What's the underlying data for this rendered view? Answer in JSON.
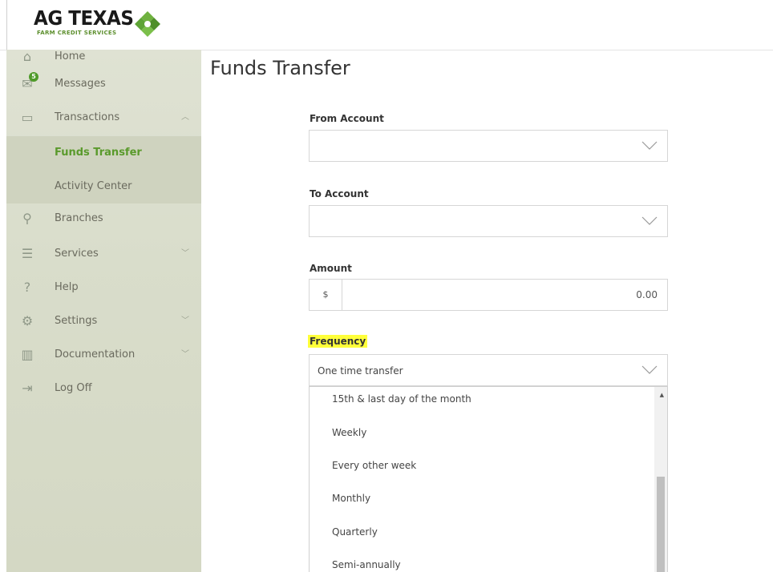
{
  "brand": {
    "name": "AG TEXAS",
    "tagline": "FARM CREDIT SERVICES",
    "accent": "#5a9a2c"
  },
  "sidebar": {
    "items": [
      {
        "label": "Home",
        "icon": "home-icon"
      },
      {
        "label": "Messages",
        "icon": "envelope-icon",
        "badge": "5"
      },
      {
        "label": "Transactions",
        "icon": "card-icon",
        "expanded": true
      },
      {
        "label": "Funds Transfer",
        "sub": true,
        "active": true
      },
      {
        "label": "Activity Center",
        "sub": true
      },
      {
        "label": "Branches",
        "icon": "location-pin-icon"
      },
      {
        "label": "Services",
        "icon": "menu-icon"
      },
      {
        "label": "Help",
        "icon": "question-icon"
      },
      {
        "label": "Settings",
        "icon": "gear-icon"
      },
      {
        "label": "Documentation",
        "icon": "chart-doc-icon"
      },
      {
        "label": "Log Off",
        "icon": "logout-icon"
      }
    ]
  },
  "main": {
    "title": "Funds Transfer",
    "from_label": "From Account",
    "from_value": "",
    "to_label": "To Account",
    "to_value": "",
    "amount_label": "Amount",
    "amount_currency": "$",
    "amount_value": "0.00",
    "frequency_label": "Frequency",
    "frequency_value": "One time transfer",
    "frequency_options": [
      "15th & last day of the month",
      "Weekly",
      "Every other week",
      "Monthly",
      "Quarterly",
      "Semi-annually"
    ]
  }
}
